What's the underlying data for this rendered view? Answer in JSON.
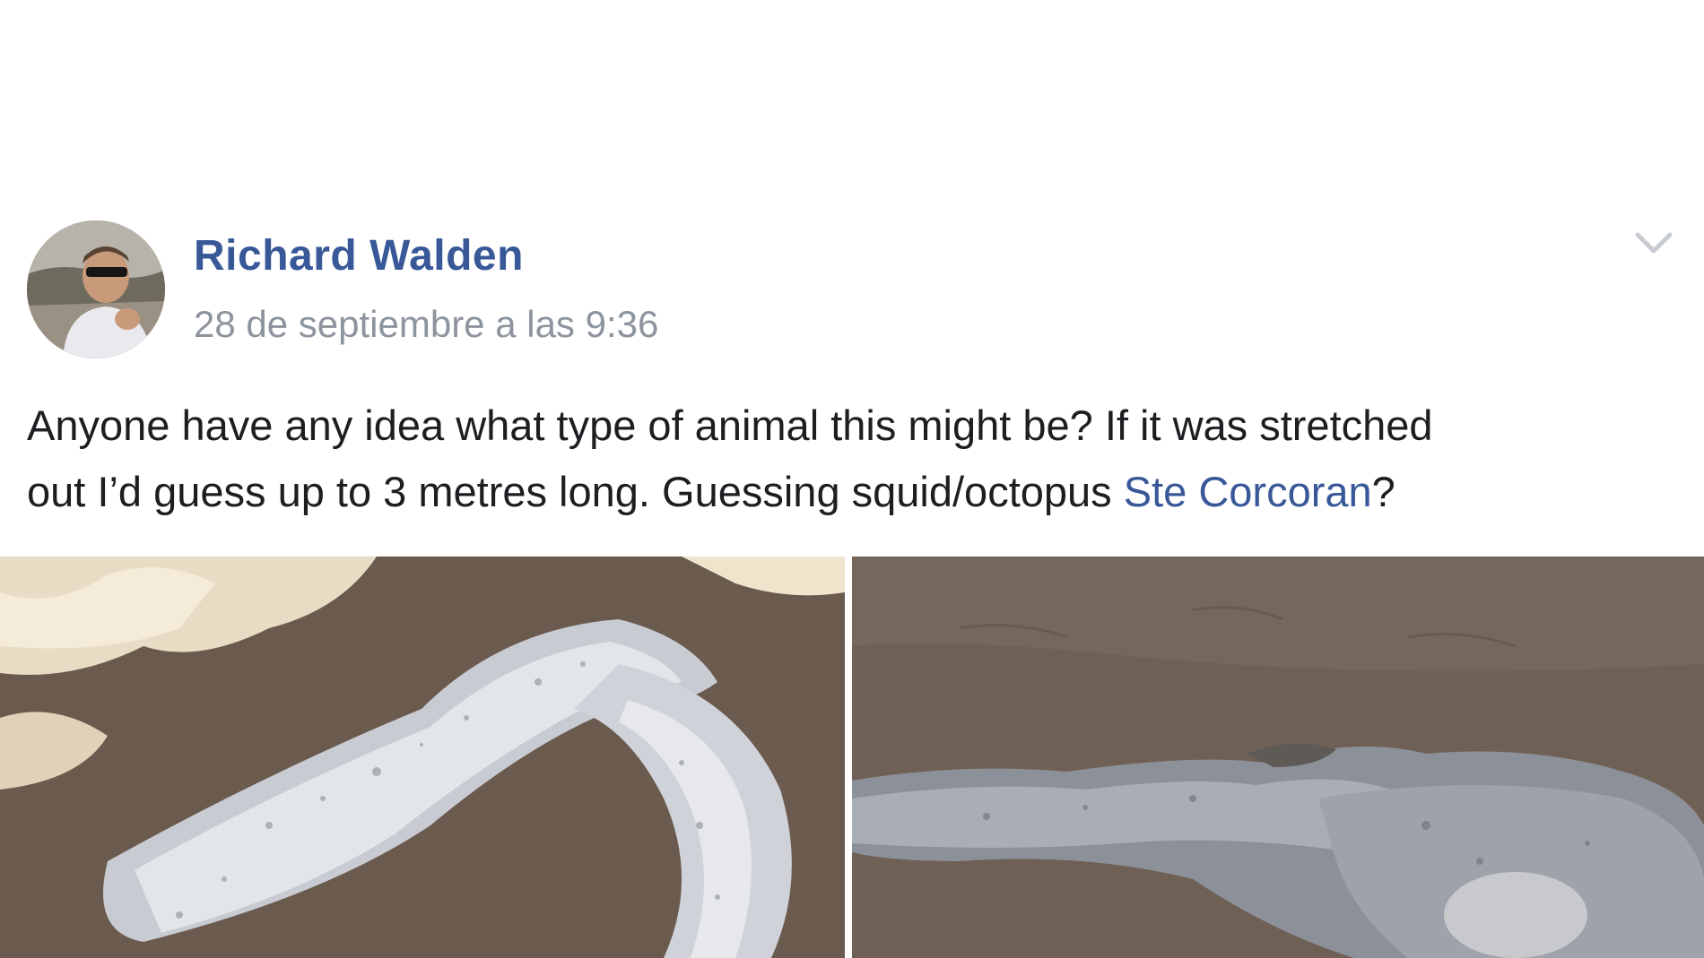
{
  "post": {
    "author": "Richard Walden",
    "timestamp": "28 de septiembre a las 9:36",
    "text_line1": "Anyone have any idea what type of animal this might be? If it was stretched",
    "text_line2_before": "out I’d guess up to 3 metres long. Guessing squid/octopus ",
    "mention": "Ste Corcoran",
    "text_line2_after": "?",
    "menu_icon": "chevron-down-icon",
    "photos": [
      {
        "name": "photo-left",
        "subject": "pale carcass on dark sand with sea foam"
      },
      {
        "name": "photo-right",
        "subject": "grey carcass on dark sand"
      }
    ]
  },
  "colors": {
    "link": "#385898",
    "text": "#1c1e21",
    "meta": "#8d949e",
    "sand": "#6b5a4e"
  }
}
